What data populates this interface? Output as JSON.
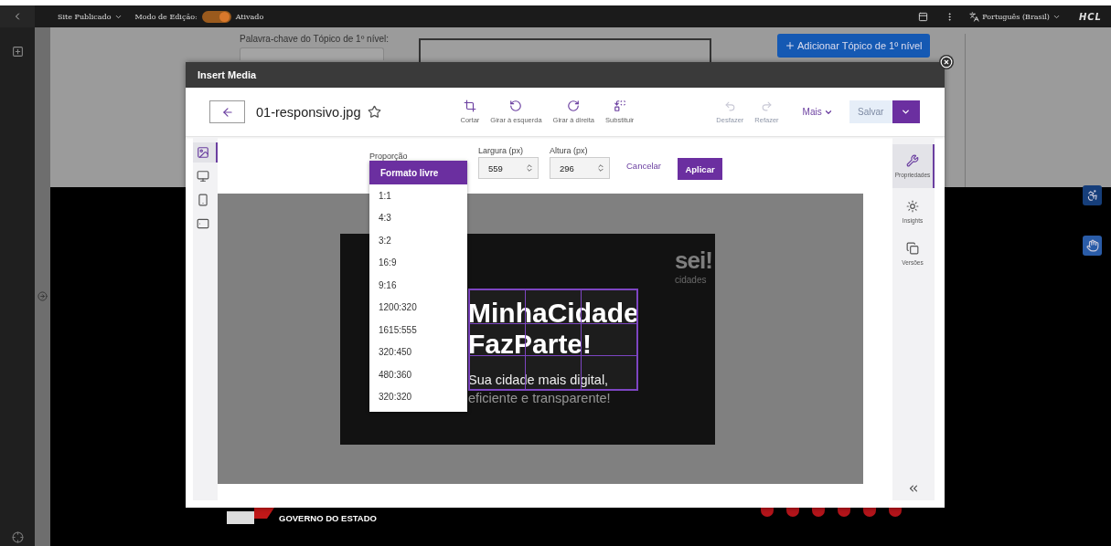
{
  "topbar": {
    "site_menu": "Site Publicado",
    "edit_mode": {
      "label": "Modo de Edição:",
      "on": true,
      "state_label": "Ativado"
    },
    "language": "Português (Brasil)",
    "logo": "HCL"
  },
  "page": {
    "keyword_label": "Palavra-chave do Tópico de 1º nível:",
    "add_button": "Adicionar Tópico de 1º nível",
    "footer_text": "GOVERNO DO ESTADO"
  },
  "modal": {
    "title": "Insert Media",
    "file_name": "01-responsivo.jpg",
    "starred": false,
    "tools": [
      {
        "kind": "crop",
        "label": "Cortar"
      },
      {
        "kind": "rotate-left",
        "label": "Girar à esquerda"
      },
      {
        "kind": "rotate-right",
        "label": "Girar à direita"
      },
      {
        "kind": "replace",
        "label": "Substituir"
      }
    ],
    "history": [
      {
        "kind": "undo",
        "label": "Desfazer",
        "disabled": true
      },
      {
        "kind": "redo",
        "label": "Refazer",
        "disabled": true
      }
    ],
    "more": "Mais",
    "save": {
      "label": "Salvar",
      "disabled": true
    },
    "views": [
      {
        "kind": "image",
        "selected": true
      },
      {
        "kind": "desktop",
        "selected": false
      },
      {
        "kind": "phone",
        "selected": false
      },
      {
        "kind": "tablet",
        "selected": false
      }
    ],
    "crop": {
      "ratio_label": "Proporção",
      "ratios": [
        {
          "label": "Formato livre",
          "selected": true
        },
        {
          "label": "1:1",
          "selected": false
        },
        {
          "label": "4:3",
          "selected": false
        },
        {
          "label": "3:2",
          "selected": false
        },
        {
          "label": "16:9",
          "selected": false
        },
        {
          "label": "9:16",
          "selected": false
        },
        {
          "label": "1200:320",
          "selected": false
        },
        {
          "label": "1615:555",
          "selected": false
        },
        {
          "label": "320:450",
          "selected": false
        },
        {
          "label": "480:360",
          "selected": false
        },
        {
          "label": "320:320",
          "selected": false
        }
      ],
      "width_label": "Largura (px)",
      "width_value": "559",
      "height_label": "Altura (px)",
      "height_value": "296",
      "cancel": "Cancelar",
      "apply": "Aplicar"
    },
    "image": {
      "logo": "sei!",
      "logo_sub": "cidades",
      "headline": [
        "MinhaCidade",
        "FazParte!"
      ],
      "tagline": [
        "Sua cidade mais digital,",
        "eficiente e transparente!"
      ]
    },
    "panel": [
      {
        "kind": "properties",
        "label": "Propriedades",
        "selected": true
      },
      {
        "kind": "insights",
        "label": "Insights",
        "selected": false
      },
      {
        "kind": "versions",
        "label": "Versões",
        "selected": false
      }
    ]
  }
}
